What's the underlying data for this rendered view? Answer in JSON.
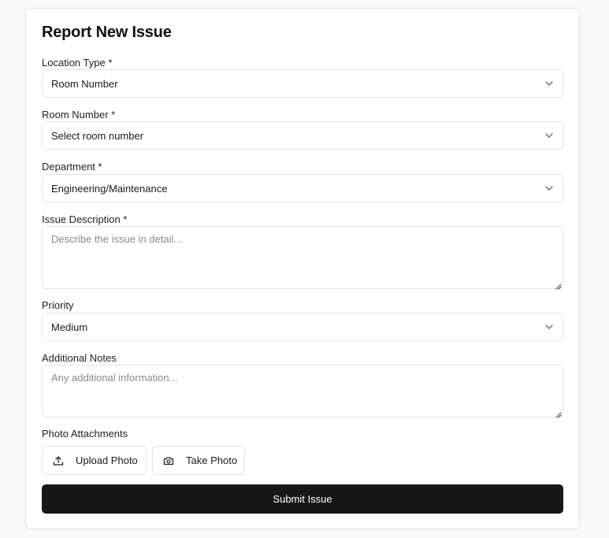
{
  "form": {
    "title": "Report New Issue",
    "location_type": {
      "label": "Location Type *",
      "value": "Room Number"
    },
    "room_number": {
      "label": "Room Number *",
      "value": "Select room number"
    },
    "department": {
      "label": "Department *",
      "value": "Engineering/Maintenance"
    },
    "issue_description": {
      "label": "Issue Description *",
      "placeholder": "Describe the issue in detail..."
    },
    "priority": {
      "label": "Priority",
      "value": "Medium"
    },
    "additional_notes": {
      "label": "Additional Notes",
      "placeholder": "Any additional information..."
    },
    "photo_attachments": {
      "label": "Photo Attachments",
      "upload_label": "Upload Photo",
      "upload_icon": "upload-icon",
      "take_label": "Take Photo",
      "take_icon": "camera-icon"
    },
    "submit_label": "Submit Issue"
  },
  "colors": {
    "page_bg": "#f9f9f9",
    "card_bg": "#ffffff",
    "border": "#e3e3e3",
    "submit_bg": "#171717",
    "submit_text": "#ffffff"
  }
}
